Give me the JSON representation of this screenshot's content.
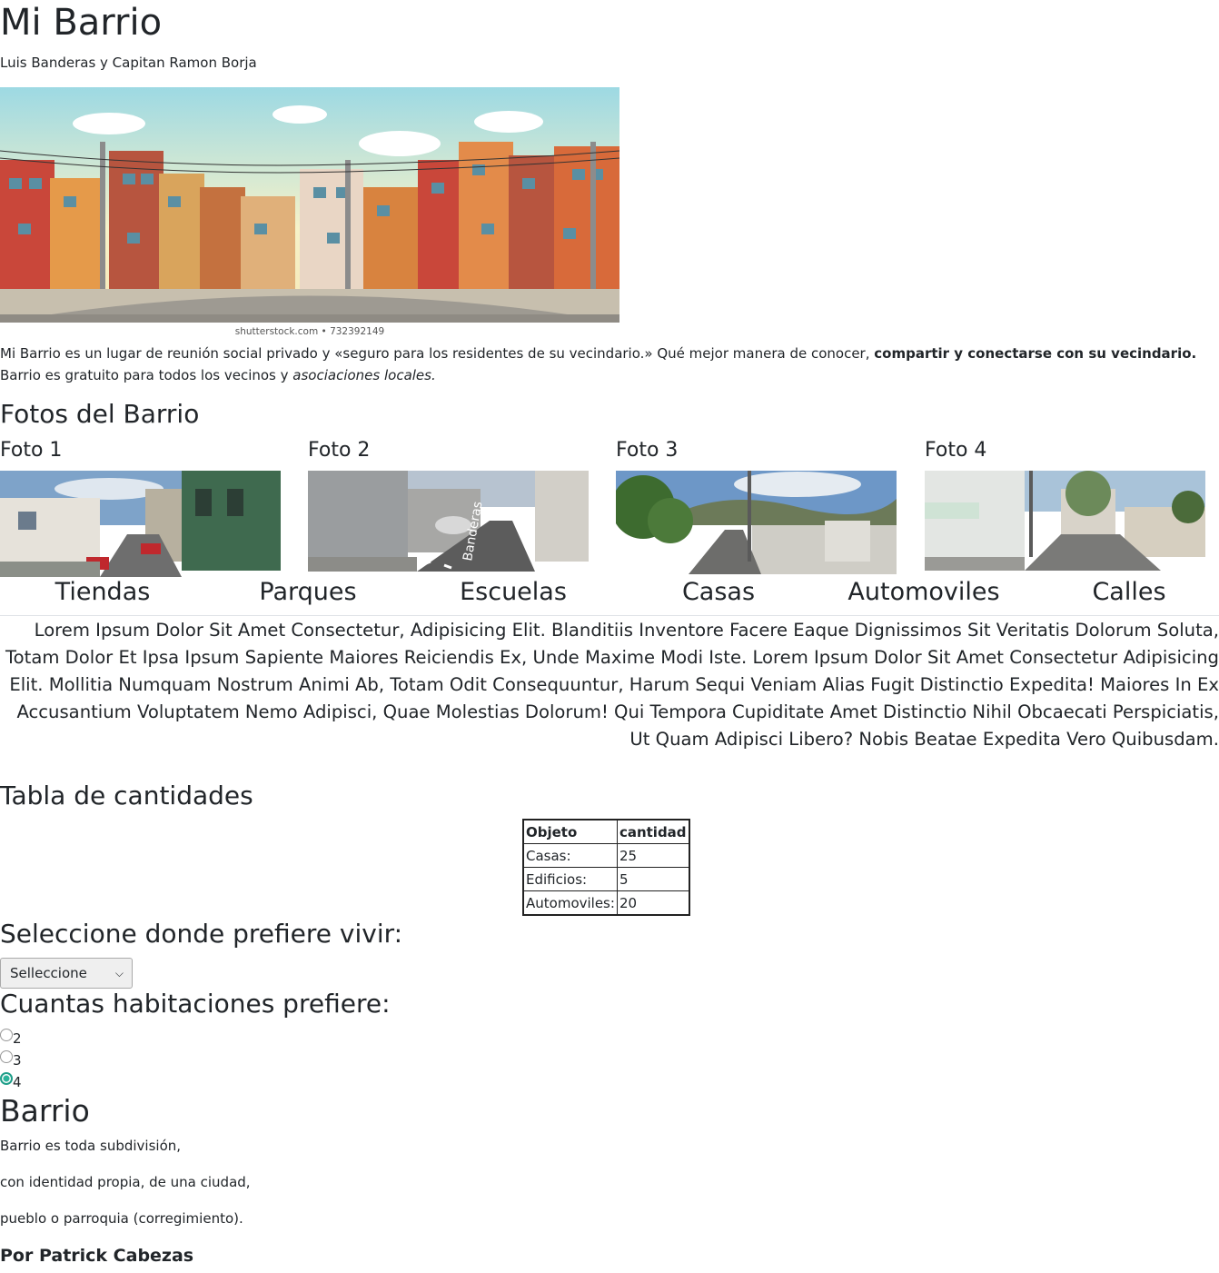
{
  "header": {
    "title": "Mi Barrio",
    "subtitle": "Luis Banderas y Capitan Ramon Borja"
  },
  "hero": {
    "caption": "shutterstock.com • 732392149"
  },
  "intro": {
    "text1": "Mi Barrio es un lugar de reunión social privado y «seguro para los residentes de su vecindario.» Qué mejor manera de conocer, ",
    "bold": "compartir y conectarse con su vecindario.",
    "text2": "Barrio es gratuito para todos los vecinos y ",
    "italic": "asociaciones locales."
  },
  "gallery": {
    "heading": "Fotos del Barrio",
    "photos": [
      {
        "title": "Foto 1"
      },
      {
        "title": "Foto 2"
      },
      {
        "title": "Foto 3"
      },
      {
        "title": "Foto 4"
      }
    ],
    "street_sign": "Banderas"
  },
  "nav": {
    "items": [
      "Tiendas",
      "Parques",
      "Escuelas",
      "Casas",
      "Automoviles",
      "Calles"
    ]
  },
  "lorem": "Lorem Ipsum Dolor Sit Amet Consectetur, Adipisicing Elit. Blanditiis Inventore Facere Eaque Dignissimos Sit Veritatis Dolorum Soluta, Totam Dolor Et Ipsa Ipsum Sapiente Maiores Reiciendis Ex, Unde Maxime Modi Iste. Lorem Ipsum Dolor Sit Amet Consectetur Adipisicing Elit. Mollitia Numquam Nostrum Animi Ab, Totam Odit Consequuntur, Harum Sequi Veniam Alias Fugit Distinctio Expedita! Maiores In Ex Accusantium Voluptatem Nemo Adipisci, Quae Molestias Dolorum! Qui Tempora Cupiditate Amet Distinctio Nihil Obcaecati Perspiciatis, Ut Quam Adipisci Libero? Nobis Beatae Expedita Vero Quibusdam.",
  "table": {
    "heading": "Tabla de cantidades",
    "headers": [
      "Objeto",
      "cantidad"
    ],
    "rows": [
      [
        "Casas:",
        "25"
      ],
      [
        "Edificios:",
        "5"
      ],
      [
        "Automoviles:",
        "20"
      ]
    ]
  },
  "form": {
    "select_heading": "Seleccione donde prefiere vivir:",
    "select_value": "Selleccione",
    "rooms_heading": "Cuantas habitaciones prefiere:",
    "room_options": [
      "2",
      "3",
      "4"
    ],
    "room_selected": "4"
  },
  "barrio": {
    "heading": "Barrio",
    "lines": [
      "Barrio es toda subdivisión,",
      "con identidad propia, de una ciudad,",
      "pueblo o parroquia (corregimiento)."
    ],
    "author": "Por Patrick Cabezas"
  }
}
